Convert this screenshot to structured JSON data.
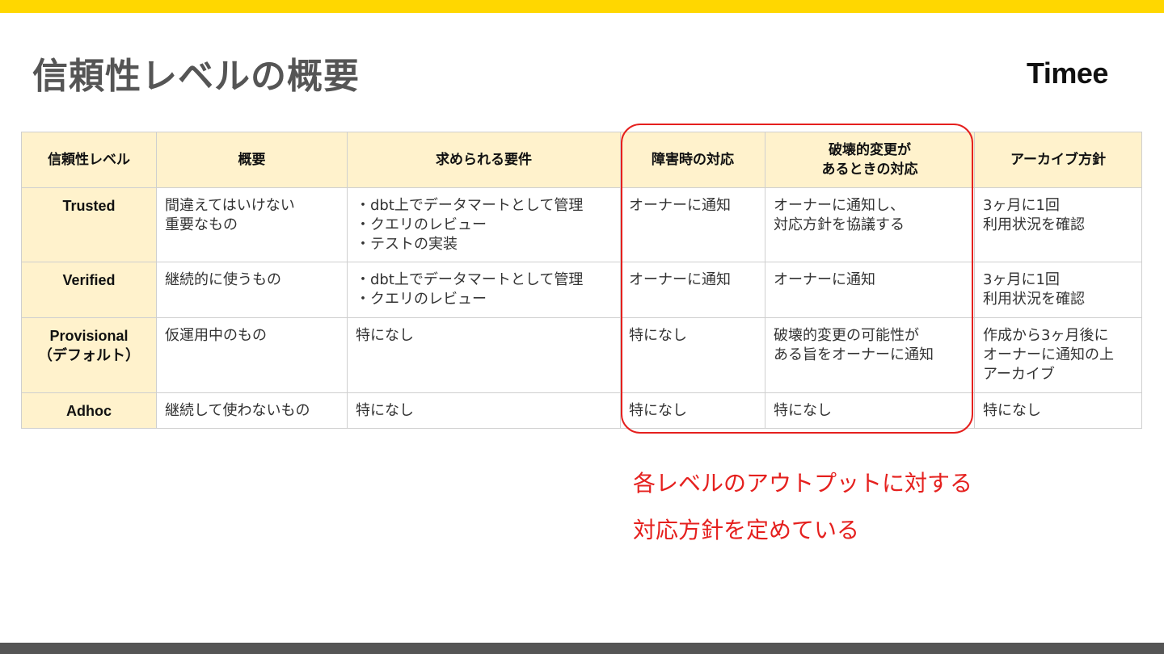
{
  "slide": {
    "title": "信頼性レベルの概要",
    "logo_text": "Timee",
    "accent_color": "#FFD700",
    "highlight_color": "#E5201E"
  },
  "table": {
    "headers": [
      "信頼性レベル",
      "概要",
      "求められる要件",
      "障害時の対応",
      "破壊的変更が|あるときの対応",
      "アーカイブ方針"
    ],
    "rows": [
      {
        "level": [
          "Trusted"
        ],
        "summary": [
          "間違えてはいけない",
          "重要なもの"
        ],
        "requirements": [
          "・dbt上でデータマートとして管理",
          "・クエリのレビュー",
          "・テストの実装"
        ],
        "incident": [
          "オーナーに通知"
        ],
        "breaking_change": [
          "オーナーに通知し、",
          "対応方針を協議する"
        ],
        "archive": [
          "3ヶ月に1回",
          "利用状況を確認"
        ]
      },
      {
        "level": [
          "Verified"
        ],
        "summary": [
          "継続的に使うもの"
        ],
        "requirements": [
          "・dbt上でデータマートとして管理",
          "・クエリのレビュー"
        ],
        "incident": [
          "オーナーに通知"
        ],
        "breaking_change": [
          "オーナーに通知"
        ],
        "archive": [
          "3ヶ月に1回",
          "利用状況を確認"
        ]
      },
      {
        "level": [
          "Provisional",
          "（デフォルト）"
        ],
        "summary": [
          "仮運用中のもの"
        ],
        "requirements": [
          "特になし"
        ],
        "incident": [
          "特になし"
        ],
        "breaking_change": [
          "破壊的変更の可能性が",
          "ある旨をオーナーに通知"
        ],
        "archive": [
          "作成から3ヶ月後に",
          "オーナーに通知の上",
          "アーカイブ"
        ]
      },
      {
        "level": [
          "Adhoc"
        ],
        "summary": [
          "継続して使わないもの"
        ],
        "requirements": [
          "特になし"
        ],
        "incident": [
          "特になし"
        ],
        "breaking_change": [
          "特になし"
        ],
        "archive": [
          "特になし"
        ]
      }
    ]
  },
  "callout": {
    "lines": [
      "各レベルのアウトプットに対する",
      "対応方針を定めている"
    ]
  }
}
